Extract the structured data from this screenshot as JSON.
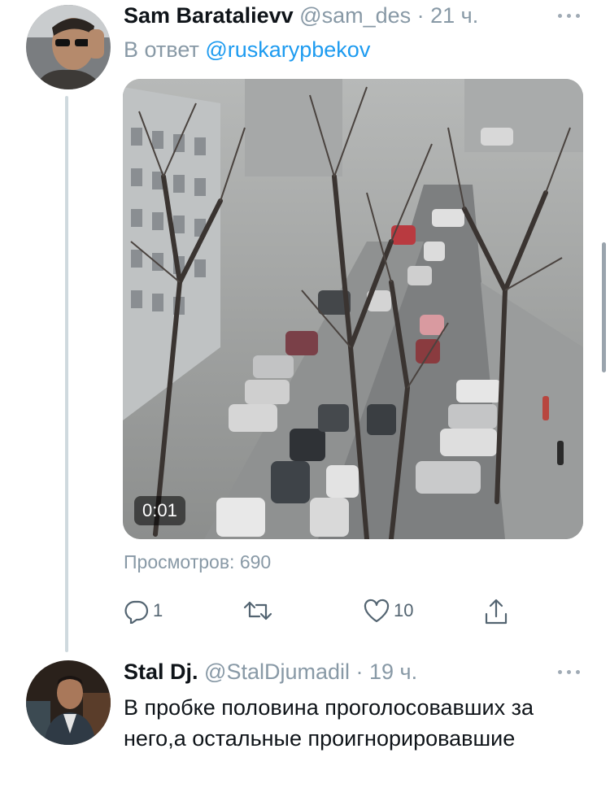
{
  "tweet1": {
    "author_name": "Sam Baratalievv",
    "handle": "@sam_des",
    "separator": " · ",
    "time": "21 ч.",
    "reply_prefix": "В ответ ",
    "reply_handle": "@ruskarypbekov",
    "media": {
      "duration": "0:01"
    },
    "views": "Просмотров: 690",
    "actions": {
      "reply_count": "1",
      "retweet_count": "",
      "like_count": "10"
    }
  },
  "tweet2": {
    "author_name": "Stal Dj.",
    "handle": "@StalDjumadil",
    "separator": " · ",
    "time": "19 ч.",
    "text": "В пробке половина проголосовавших за него,а остальные проигнорировавшие"
  },
  "colors": {
    "link": "#1d9bf0",
    "muted": "#8899a6",
    "thread_line": "#cfd9de"
  }
}
